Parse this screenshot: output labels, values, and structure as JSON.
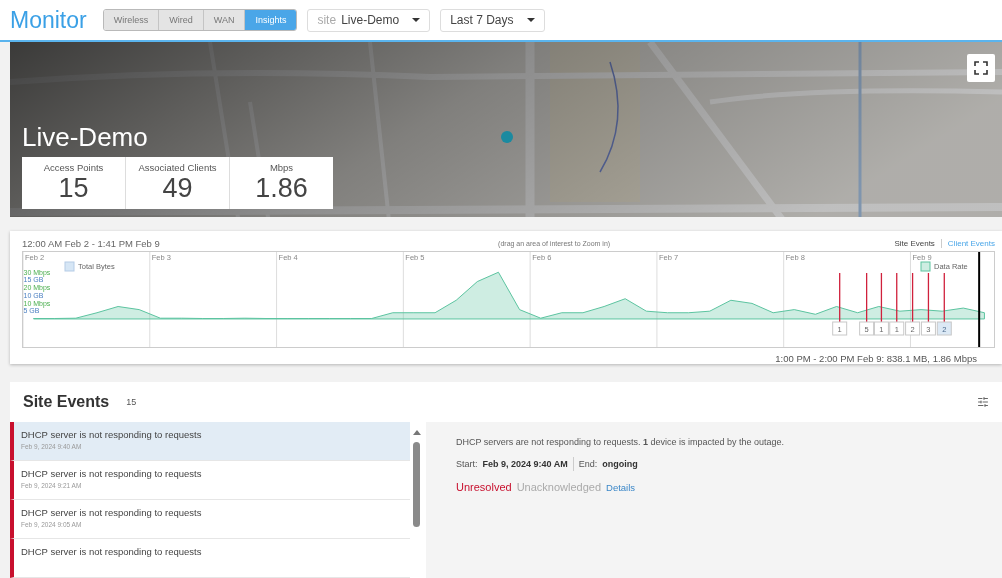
{
  "header": {
    "title": "Monitor",
    "tabs": [
      {
        "label": "Wireless",
        "selected": false
      },
      {
        "label": "Wired",
        "selected": false
      },
      {
        "label": "WAN",
        "selected": false
      },
      {
        "label": "Insights",
        "selected": true
      }
    ],
    "site_select": {
      "prefix": "site",
      "value": "Live-Demo"
    },
    "range_select": {
      "value": "Last 7 Days"
    }
  },
  "map": {
    "kind": "picture",
    "site_name": "Live-Demo",
    "stats": [
      {
        "label": "Access Points",
        "value": "15"
      },
      {
        "label": "Associated Clients",
        "value": "49"
      },
      {
        "label": "Mbps",
        "value": "1.86"
      }
    ]
  },
  "timeline": {
    "range": "12:00 AM Feb 2 - 1:41 PM Feb 9",
    "hint": "(drag an area of interest to Zoom in)",
    "event_tabs": [
      {
        "label": "Site Events",
        "selected": true
      },
      {
        "label": "Client Events",
        "selected": false
      }
    ],
    "legend": [
      {
        "label": "Total Bytes",
        "color": "#d6e6f5"
      }
    ],
    "event_markers": [
      {
        "selected": false
      },
      {
        "selected": false
      },
      {
        "selected": false
      },
      {
        "selected": false
      },
      {
        "selected": false
      },
      {
        "selected": false
      },
      {
        "selected": true
      }
    ],
    "gb_ticks": [
      "15 GB",
      "10 GB",
      "5 GB"
    ],
    "chart_data": {
      "type": "area",
      "categories": [
        "Feb 2",
        null,
        null,
        null,
        null,
        null,
        "Feb 3",
        null,
        null,
        null,
        null,
        null,
        "Feb 4",
        null,
        null,
        null,
        null,
        null,
        "Feb 5",
        null,
        null,
        null,
        null,
        null,
        "Feb 6",
        null,
        null,
        null,
        null,
        null,
        "Feb 7",
        null,
        null,
        null,
        null,
        null,
        "Feb 8",
        null,
        null,
        null,
        null,
        null,
        "Feb 9",
        null,
        null,
        null
      ],
      "series": [
        {
          "name": "Data Rate",
          "color": "#5cc4a0",
          "values": [
            0.3,
            0.3,
            0.5,
            4,
            8,
            6,
            0.5,
            0.5,
            0.3,
            0.3,
            0.5,
            0.3,
            0.3,
            0.3,
            0.3,
            0.3,
            0.3,
            4,
            4,
            4,
            12,
            24,
            30,
            6,
            0.5,
            4,
            4,
            8,
            13,
            5,
            4,
            4,
            5,
            12,
            10,
            4,
            6,
            3,
            8,
            4,
            8,
            5,
            6,
            5,
            7,
            4
          ]
        }
      ],
      "ylim": [
        -18,
        43
      ],
      "yticks": [
        {
          "value": 30,
          "label": "30 Mbps"
        },
        {
          "value": 20,
          "label": "20 Mbps"
        },
        {
          "value": 10,
          "label": "10 Mbps"
        }
      ],
      "annotations": [
        "1",
        "5",
        "1",
        "1",
        "2",
        "3",
        "2"
      ]
    },
    "summary": "1:00 PM - 2:00 PM Feb 9: 838.1 MB, 1.86 Mbps"
  },
  "events": {
    "title": "Site Events",
    "count": "15",
    "items": [
      {
        "title": "DHCP server is not responding to requests",
        "time": "Feb 9, 2024 9:40 AM",
        "selected": true
      },
      {
        "title": "DHCP server is not responding to requests",
        "time": "Feb 9, 2024 9:21 AM",
        "selected": false
      },
      {
        "title": "DHCP server is not responding to requests",
        "time": "Feb 9, 2024 9:05 AM",
        "selected": false
      },
      {
        "title": "DHCP server is not responding to requests",
        "selected": false
      }
    ],
    "detail": {
      "description": "DHCP servers are not responding to requests. **1** device is impacted by the outage.",
      "start_label": "Start:",
      "start": "Feb 9, 2024 9:40 AM",
      "end_label": "End:",
      "end": "ongoing",
      "status": "Unresolved",
      "acknowledgement": "Unacknowledged",
      "link": "Details"
    }
  }
}
